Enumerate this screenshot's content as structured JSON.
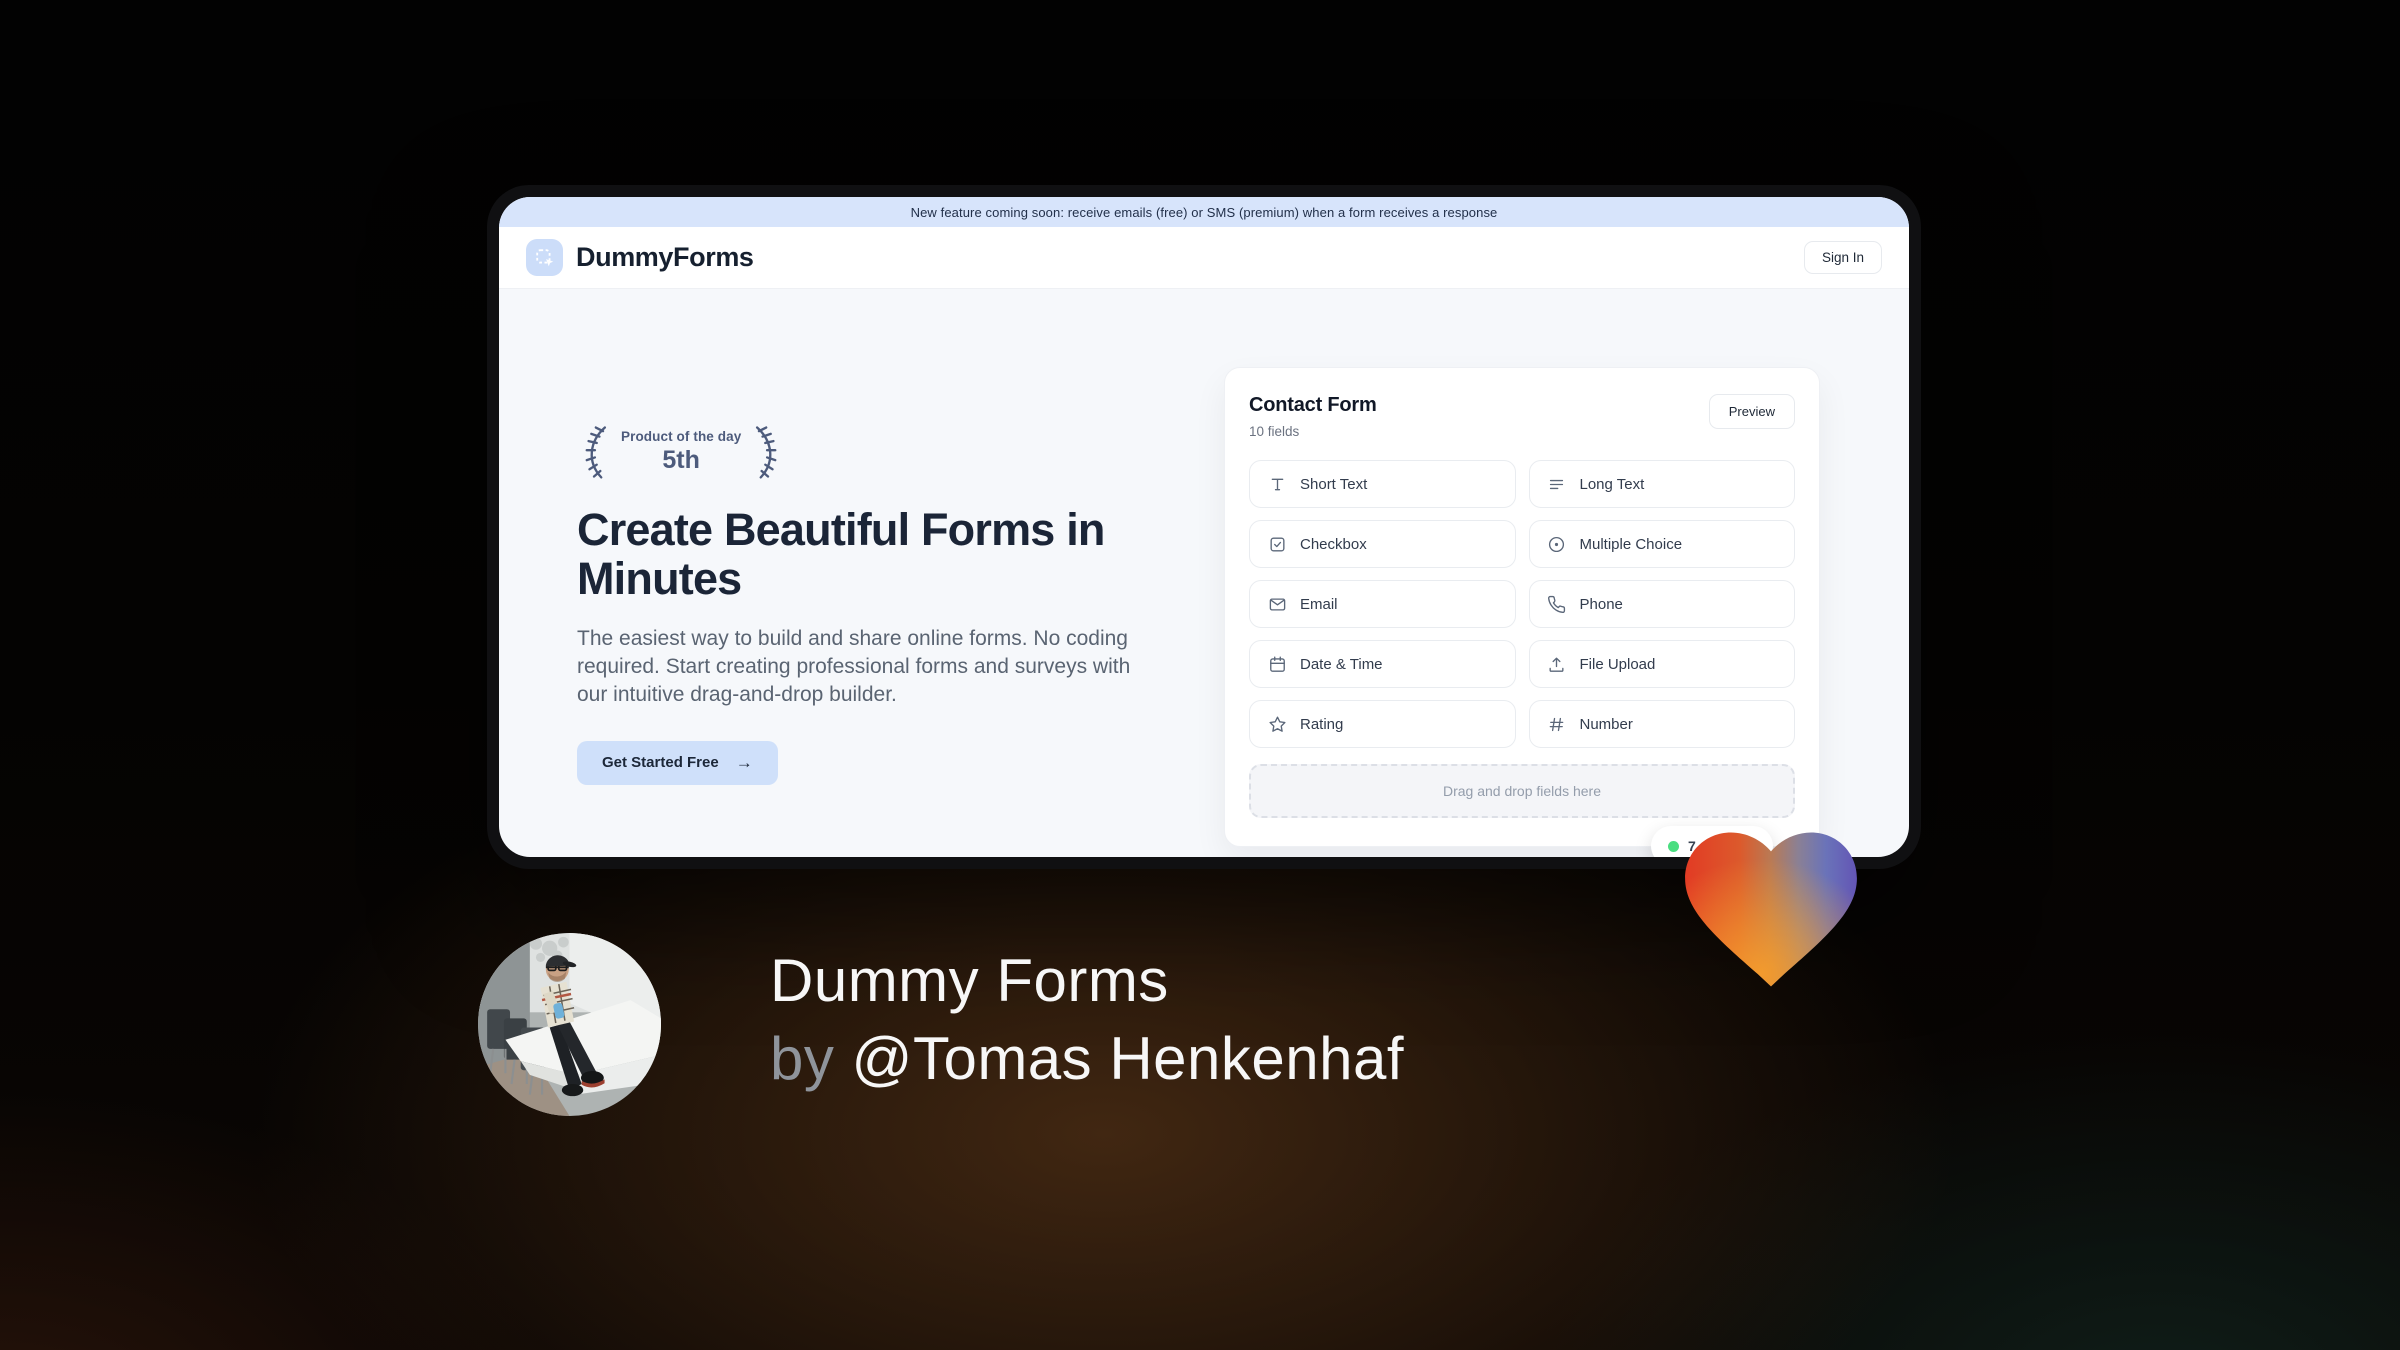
{
  "banner": {
    "text": "New feature coming soon: receive emails (free) or SMS (premium) when a form receives a response"
  },
  "header": {
    "brand": "DummyForms",
    "sign_in_label": "Sign In"
  },
  "hero": {
    "award": {
      "title": "Product of the day",
      "rank": "5th"
    },
    "title": "Create Beautiful Forms in Minutes",
    "description": "The easiest way to build and share online forms. No coding required. Start creating professional forms and surveys with our intuitive drag-and-drop builder.",
    "cta_label": "Get Started Free",
    "cta_arrow": "→"
  },
  "form_card": {
    "title": "Contact Form",
    "subtitle": "10 fields",
    "preview_label": "Preview",
    "fields": [
      {
        "label": "Short Text",
        "icon": "short-text-icon"
      },
      {
        "label": "Long Text",
        "icon": "long-text-icon"
      },
      {
        "label": "Checkbox",
        "icon": "checkbox-icon"
      },
      {
        "label": "Multiple Choice",
        "icon": "radio-icon"
      },
      {
        "label": "Email",
        "icon": "envelope-icon"
      },
      {
        "label": "Phone",
        "icon": "phone-icon"
      },
      {
        "label": "Date & Time",
        "icon": "calendar-icon"
      },
      {
        "label": "File Upload",
        "icon": "upload-icon"
      },
      {
        "label": "Rating",
        "icon": "star-icon"
      },
      {
        "label": "Number",
        "icon": "hash-icon"
      }
    ],
    "dropzone_text": "Drag and drop fields here",
    "status_badge": {
      "visible_text": "7",
      "dot_color": "#4ade80"
    }
  },
  "footer": {
    "title": "Dummy Forms",
    "byline_prefix": "by ",
    "byline_handle": "@Tomas Henkenhaf"
  },
  "colors": {
    "banner_bg": "#d7e4fb",
    "accent_blue": "#cfe0fa",
    "logo_bg": "#ccddf9",
    "status_green": "#4ade80",
    "heart_red": "#e23b24",
    "heart_orange": "#f59d2c",
    "heart_purple": "#6355b5"
  }
}
